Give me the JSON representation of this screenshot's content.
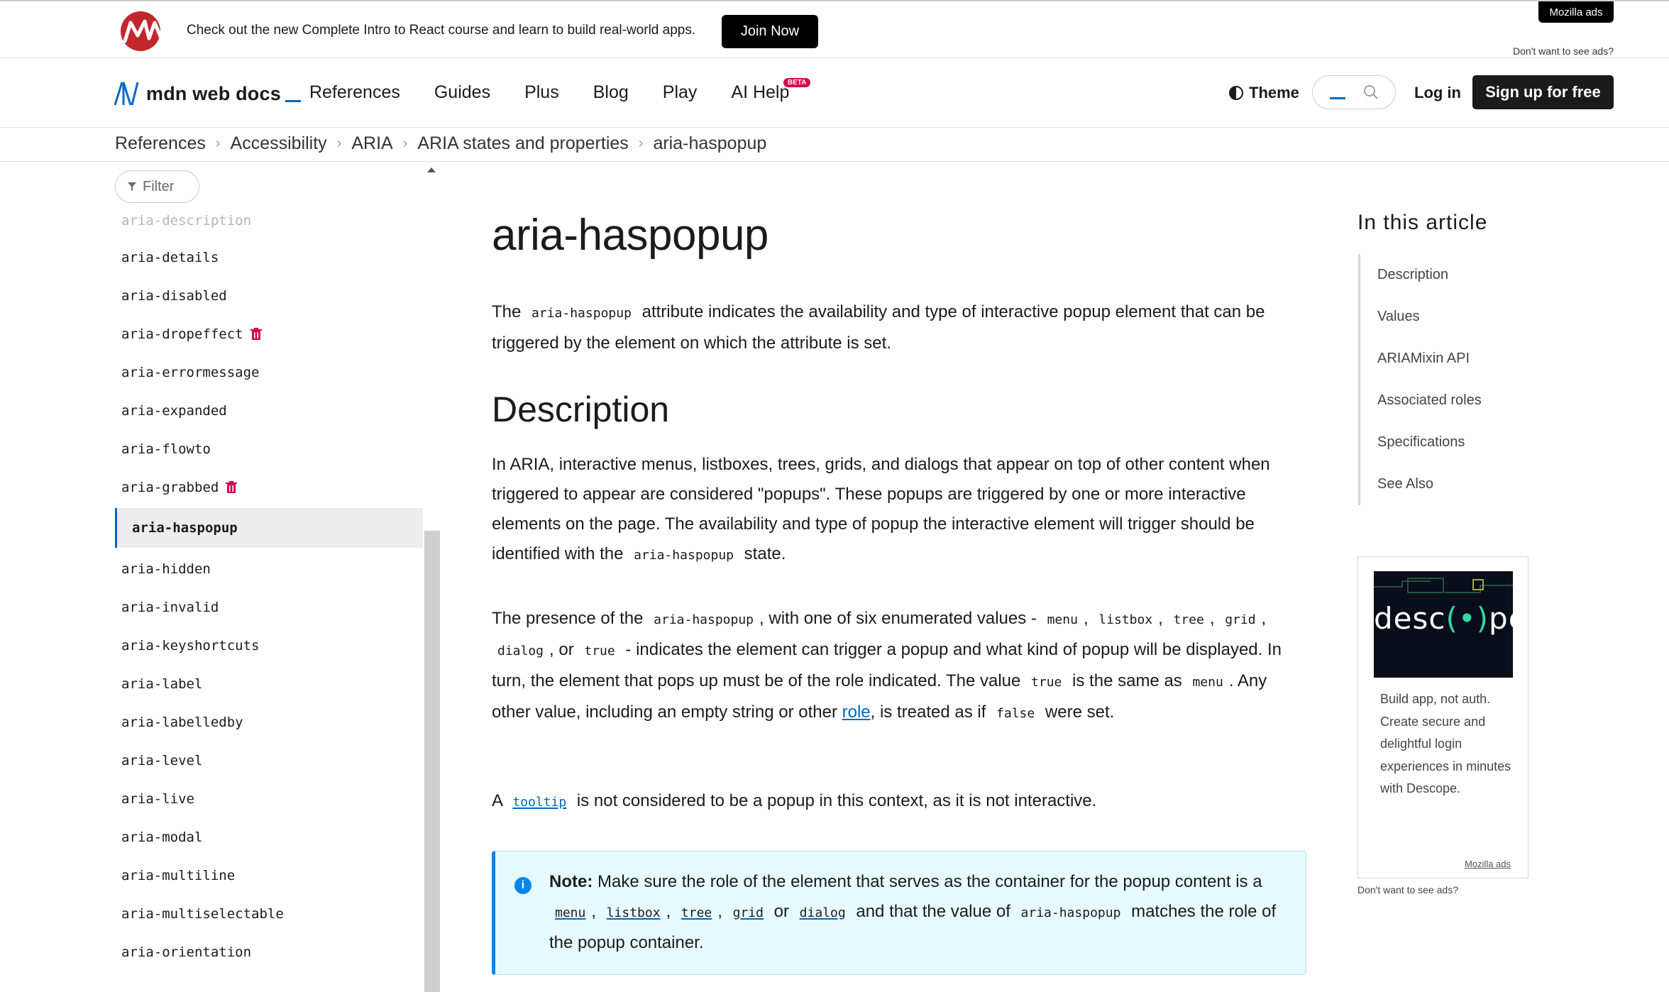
{
  "banner": {
    "text": "Check out the new Complete Intro to React course and learn to build real-world apps.",
    "cta": "Join Now",
    "ads_label": "Mozilla ads",
    "dont_want": "Don't want to see ads?"
  },
  "header": {
    "logo_text": "mdn web docs",
    "nav": [
      "References",
      "Guides",
      "Plus",
      "Blog",
      "Play",
      "AI Help"
    ],
    "beta_badge": "BETA",
    "theme": "Theme",
    "login": "Log in",
    "signup": "Sign up for free"
  },
  "breadcrumb": [
    "References",
    "Accessibility",
    "ARIA",
    "ARIA states and properties",
    "aria-haspopup"
  ],
  "sidebar": {
    "filter_placeholder": "Filter",
    "items": [
      {
        "label": "aria-description",
        "state": "faded"
      },
      {
        "label": "aria-details"
      },
      {
        "label": "aria-disabled"
      },
      {
        "label": "aria-dropeffect",
        "deprecated": true
      },
      {
        "label": "aria-errormessage"
      },
      {
        "label": "aria-expanded"
      },
      {
        "label": "aria-flowto"
      },
      {
        "label": "aria-grabbed",
        "deprecated": true
      },
      {
        "label": "aria-haspopup",
        "state": "active"
      },
      {
        "label": "aria-hidden"
      },
      {
        "label": "aria-invalid"
      },
      {
        "label": "aria-keyshortcuts"
      },
      {
        "label": "aria-label"
      },
      {
        "label": "aria-labelledby"
      },
      {
        "label": "aria-level"
      },
      {
        "label": "aria-live"
      },
      {
        "label": "aria-modal"
      },
      {
        "label": "aria-multiline"
      },
      {
        "label": "aria-multiselectable"
      },
      {
        "label": "aria-orientation"
      }
    ]
  },
  "article": {
    "title": "aria-haspopup",
    "intro": {
      "t1": "The ",
      "c1": "aria-haspopup",
      "t2": " attribute indicates the availability and type of interactive popup element that can be triggered by the element on which the attribute is set."
    },
    "description_heading": "Description",
    "p1": {
      "t1": "In ARIA, interactive menus, listboxes, trees, grids, and dialogs that appear on top of other content when triggered to appear are considered \"popups\". These popups are triggered by one or more interactive elements on the page. The availability and type of popup the interactive element will trigger should be identified with the ",
      "c1": "aria-haspopup",
      "t2": " state."
    },
    "p2": {
      "t1": "The presence of the ",
      "c1": "aria-haspopup",
      "t2": ", with one of six enumerated values - ",
      "c2": "menu",
      "s1": ", ",
      "c3": "listbox",
      "s2": ", ",
      "c4": "tree",
      "s3": ", ",
      "c5": "grid",
      "s4": ", ",
      "c6": "dialog",
      "s5": ", or ",
      "c7": "true",
      "t3": " - indicates the element can trigger a popup and what kind of popup will be displayed. In turn, the element that pops up must be of the role indicated. The value ",
      "c8": "true",
      "t4": " is the same as ",
      "c9": "menu",
      "t5": ". Any other value, including an empty string or other ",
      "link": "role",
      "t6": ", is treated as if ",
      "c10": "false",
      "t7": " were set."
    },
    "p3": {
      "t1": "A ",
      "link": "tooltip",
      "t2": " is not considered to be a popup in this context, as it is not interactive."
    },
    "note": {
      "label": "Note:",
      "t1": " Make sure the role of the element that serves as the container for the popup content is a ",
      "l1": "menu",
      "s1": ", ",
      "l2": "listbox",
      "s2": ", ",
      "l3": "tree",
      "s3": ", ",
      "l4": "grid",
      "s4": " or ",
      "l5": "dialog",
      "t2": " and that the value of ",
      "c1": "aria-haspopup",
      "t3": " matches the role of the popup container."
    }
  },
  "toc": {
    "title": "In this article",
    "items": [
      "Description",
      "Values",
      "ARIAMixin API",
      "Associated roles",
      "Specifications",
      "See Also"
    ]
  },
  "side_ad": {
    "brand_pre": "desc",
    "brand_mark": "(•)",
    "brand_post": "pe",
    "copy": "Build app, not auth. Create secure and delightful login experiences in minutes with Descope.",
    "ads_label": "Mozilla ads",
    "dont_want": "Don't want to see ads?"
  },
  "colors": {
    "accent": "#0069c2",
    "deprecated": "#d3004b",
    "note_bg": "#e6fbff",
    "note_border": "#0085f2"
  }
}
